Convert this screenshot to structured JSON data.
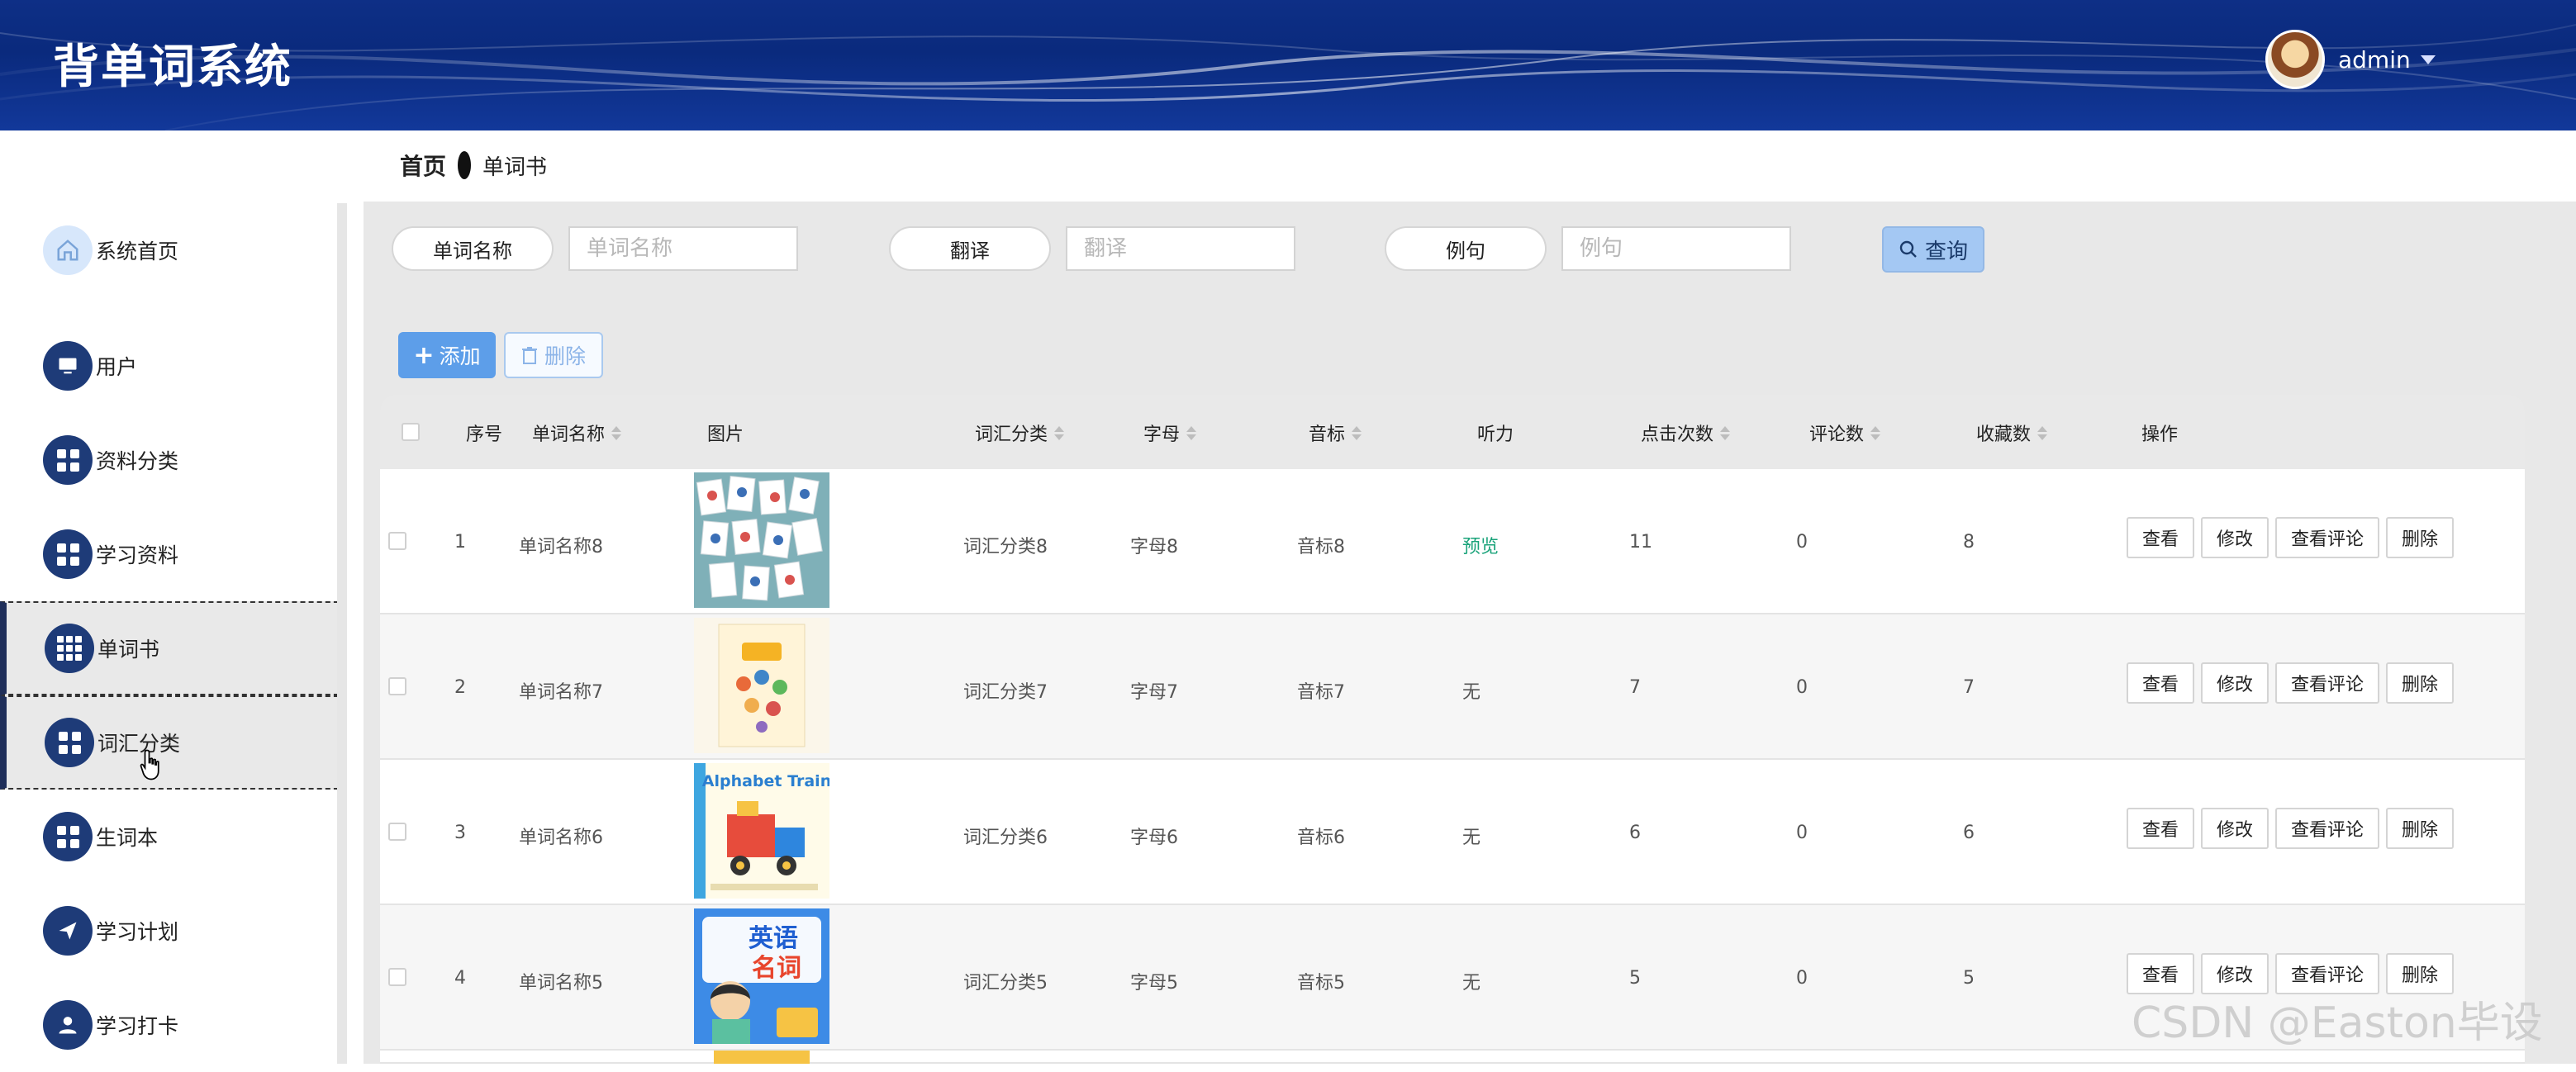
{
  "app": {
    "title": "背单词系统"
  },
  "user": {
    "name": "admin"
  },
  "breadcrumb": {
    "home": "首页",
    "current": "单词书"
  },
  "sidebar": {
    "items": [
      {
        "label": "系统首页",
        "icon": "home-icon"
      },
      {
        "label": "用户",
        "icon": "monitor-icon"
      },
      {
        "label": "资料分类",
        "icon": "grid-icon"
      },
      {
        "label": "学习资料",
        "icon": "grid-icon"
      },
      {
        "label": "单词书",
        "icon": "grid9-icon",
        "active": true
      },
      {
        "label": "词汇分类",
        "icon": "grid-icon",
        "active": true
      },
      {
        "label": "生词本",
        "icon": "grid-icon"
      },
      {
        "label": "学习计划",
        "icon": "send-icon"
      },
      {
        "label": "学习打卡",
        "icon": "user-icon"
      }
    ]
  },
  "search": {
    "fields": [
      {
        "label": "单词名称",
        "placeholder": "单词名称"
      },
      {
        "label": "翻译",
        "placeholder": "翻译"
      },
      {
        "label": "例句",
        "placeholder": "例句"
      }
    ],
    "query_label": "查询"
  },
  "toolbar": {
    "add_label": "添加",
    "delete_label": "删除"
  },
  "table": {
    "headers": [
      "序号",
      "单词名称",
      "图片",
      "词汇分类",
      "字母",
      "音标",
      "听力",
      "点击次数",
      "评论数",
      "收藏数",
      "操作"
    ],
    "rows": [
      {
        "index": "1",
        "name": "单词名称8",
        "category": "词汇分类8",
        "letter": "字母8",
        "phonetic": "音标8",
        "audio": "预览",
        "clicks": "11",
        "comments": "0",
        "favorites": "8"
      },
      {
        "index": "2",
        "name": "单词名称7",
        "category": "词汇分类7",
        "letter": "字母7",
        "phonetic": "音标7",
        "audio": "无",
        "clicks": "7",
        "comments": "0",
        "favorites": "7"
      },
      {
        "index": "3",
        "name": "单词名称6",
        "category": "词汇分类6",
        "letter": "字母6",
        "phonetic": "音标6",
        "audio": "无",
        "clicks": "6",
        "comments": "0",
        "favorites": "6"
      },
      {
        "index": "4",
        "name": "单词名称5",
        "category": "词汇分类5",
        "letter": "字母5",
        "phonetic": "音标5",
        "audio": "无",
        "clicks": "5",
        "comments": "0",
        "favorites": "5"
      }
    ],
    "actions": [
      "查看",
      "修改",
      "查看评论",
      "删除"
    ],
    "thumb_texts": {
      "train": "Alphabet Train",
      "nouns_line1": "英语",
      "nouns_line2": "名词"
    }
  },
  "watermark": "CSDN @Easton毕设",
  "colors": {
    "header": "#0e2f86",
    "menu_icon": "#1e3b78",
    "accent": "#5d9ee9",
    "preview": "#1aa37a"
  }
}
